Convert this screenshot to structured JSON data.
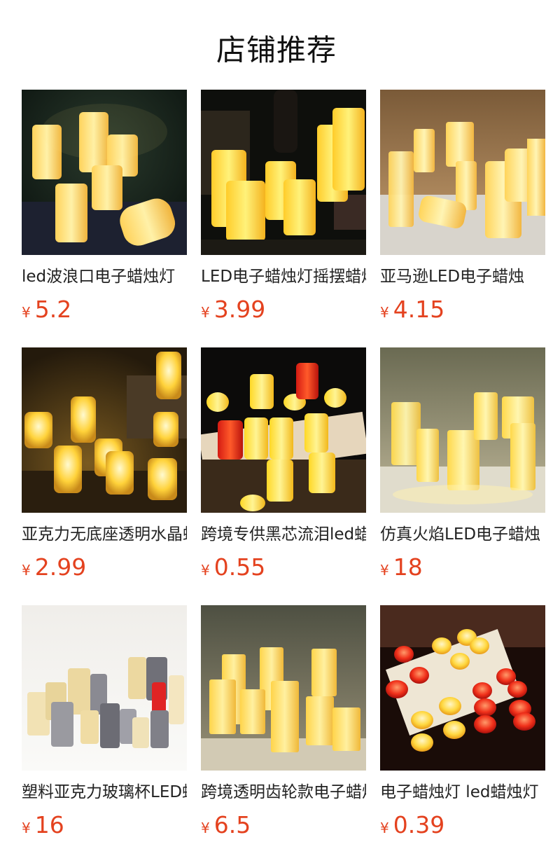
{
  "section": {
    "title": "店铺推荐"
  },
  "products": [
    {
      "name": "led波浪口电子蜡烛灯",
      "currency": "¥",
      "price": "5.2",
      "image": "wavy-top-pillar-candles-photo"
    },
    {
      "name": "LED电子蜡烛灯摇摆蜡烛",
      "currency": "¥",
      "price": "3.99",
      "image": "swing-flame-pillar-candles-photo"
    },
    {
      "name": "亚马逊LED电子蜡烛",
      "currency": "¥",
      "price": "4.15",
      "image": "glass-jar-candles-photo"
    },
    {
      "name": "亚克力无底座透明水晶蜡烛",
      "currency": "¥",
      "price": "2.99",
      "image": "acrylic-crystal-tealights-photo"
    },
    {
      "name": "跨境专供黑芯流泪led蜡烛",
      "currency": "¥",
      "price": "0.55",
      "image": "dripping-tealights-photo"
    },
    {
      "name": "仿真火焰LED电子蜡烛",
      "currency": "¥",
      "price": "18",
      "image": "string-light-glass-candles-photo"
    },
    {
      "name": "塑料亚克力玻璃杯LED蜡烛",
      "currency": "¥",
      "price": "16",
      "image": "colored-glass-cup-candles-photo"
    },
    {
      "name": "跨境透明齿轮款电子蜡烛",
      "currency": "¥",
      "price": "6.5",
      "image": "ribbed-glass-candles-photo"
    },
    {
      "name": "电子蜡烛灯 led蜡烛灯",
      "currency": "¥",
      "price": "0.39",
      "image": "heart-tealights-photo"
    }
  ]
}
